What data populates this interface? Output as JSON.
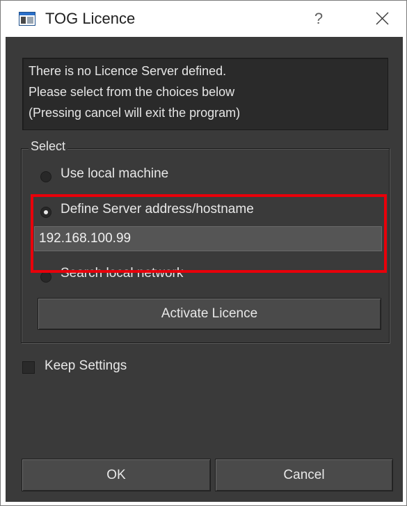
{
  "window": {
    "title": "TOG Licence",
    "help_symbol": "?",
    "icons": {
      "app": "app-window-icon",
      "close": "close-icon"
    }
  },
  "info": {
    "lines": [
      "There is no Licence Server defined.",
      "Please select from the choices below",
      "(Pressing cancel will exit the program)"
    ]
  },
  "select_group": {
    "legend": "Select",
    "options": [
      {
        "label": "Use local machine",
        "selected": false
      },
      {
        "label": "Define Server address/hostname",
        "selected": true
      },
      {
        "label": "Search local network",
        "selected": false
      }
    ],
    "server_address": "192.168.100.99",
    "activate_button": "Activate Licence"
  },
  "keep_settings": {
    "label": "Keep Settings",
    "checked": false
  },
  "buttons": {
    "ok": "OK",
    "cancel": "Cancel"
  },
  "colors": {
    "background": "#3a3a3a",
    "highlight": "#e8000a",
    "text": "#e8e8e8"
  }
}
